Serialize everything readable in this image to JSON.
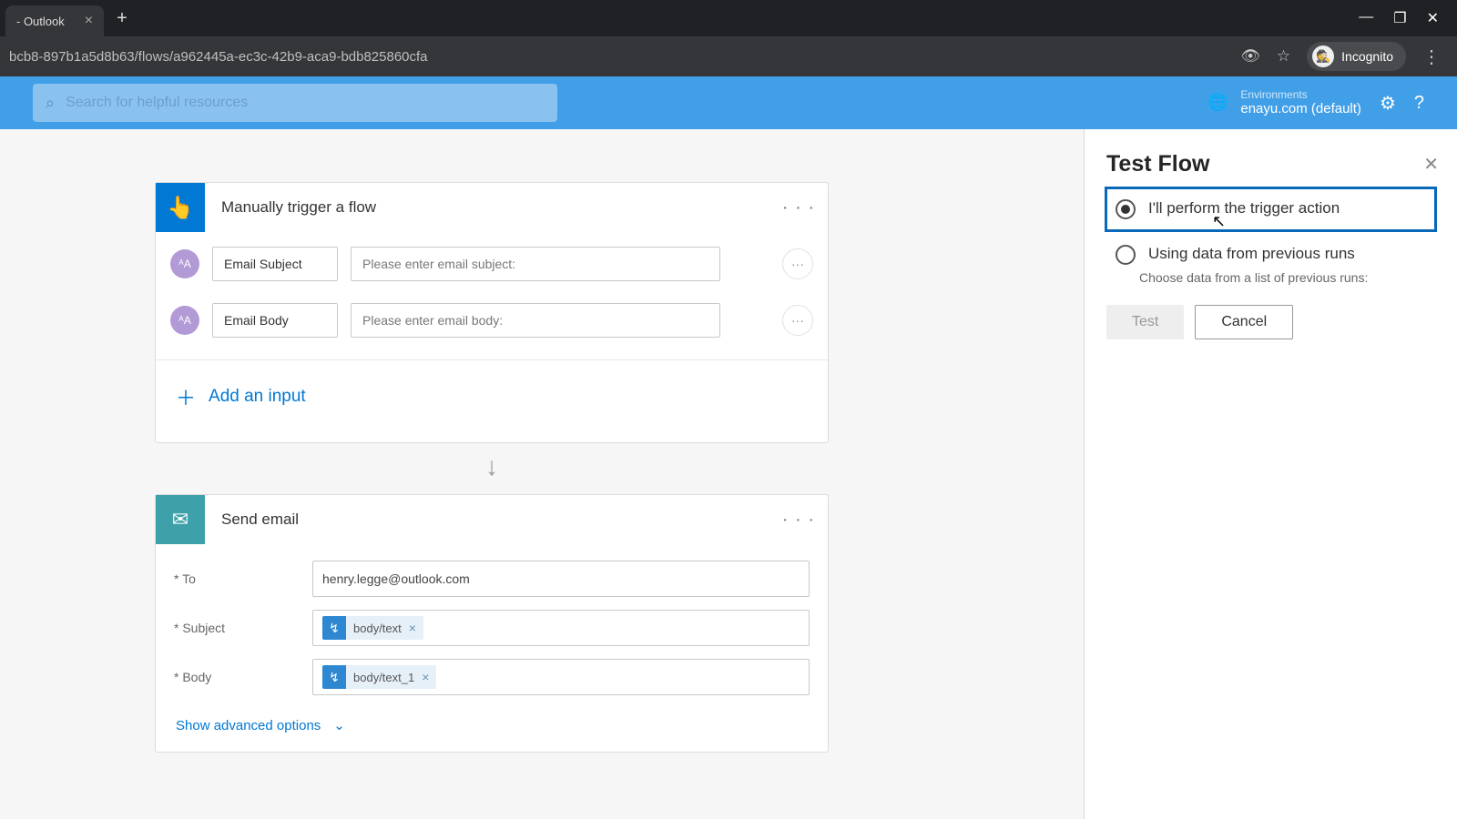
{
  "browser": {
    "tab_title": "- Outlook",
    "url_fragment": "bcb8-897b1a5d8b63/flows/a962445a-ec3c-42b9-aca9-bdb825860cfa",
    "incognito_label": "Incognito"
  },
  "topbar": {
    "search_placeholder": "Search for helpful resources",
    "env_label": "Environments",
    "env_name": "enayu.com (default)",
    "close_tooltip": "Close"
  },
  "trigger_card": {
    "title": "Manually trigger a flow",
    "inputs": [
      {
        "label": "Email Subject",
        "placeholder": "Please enter email subject:"
      },
      {
        "label": "Email Body",
        "placeholder": "Please enter email body:"
      }
    ],
    "add_input": "Add an input"
  },
  "send_card": {
    "title": "Send email",
    "to_label": "* To",
    "to_value": "henry.legge@outlook.com",
    "subject_label": "* Subject",
    "subject_token": "body/text",
    "body_label": "* Body",
    "body_token": "body/text_1",
    "advanced": "Show advanced options"
  },
  "panel": {
    "title": "Test Flow",
    "opt1": "I'll perform the trigger action",
    "opt2": "Using data from previous runs",
    "opt2_sub": "Choose data from a list of previous runs:",
    "test_btn": "Test",
    "cancel_btn": "Cancel"
  }
}
